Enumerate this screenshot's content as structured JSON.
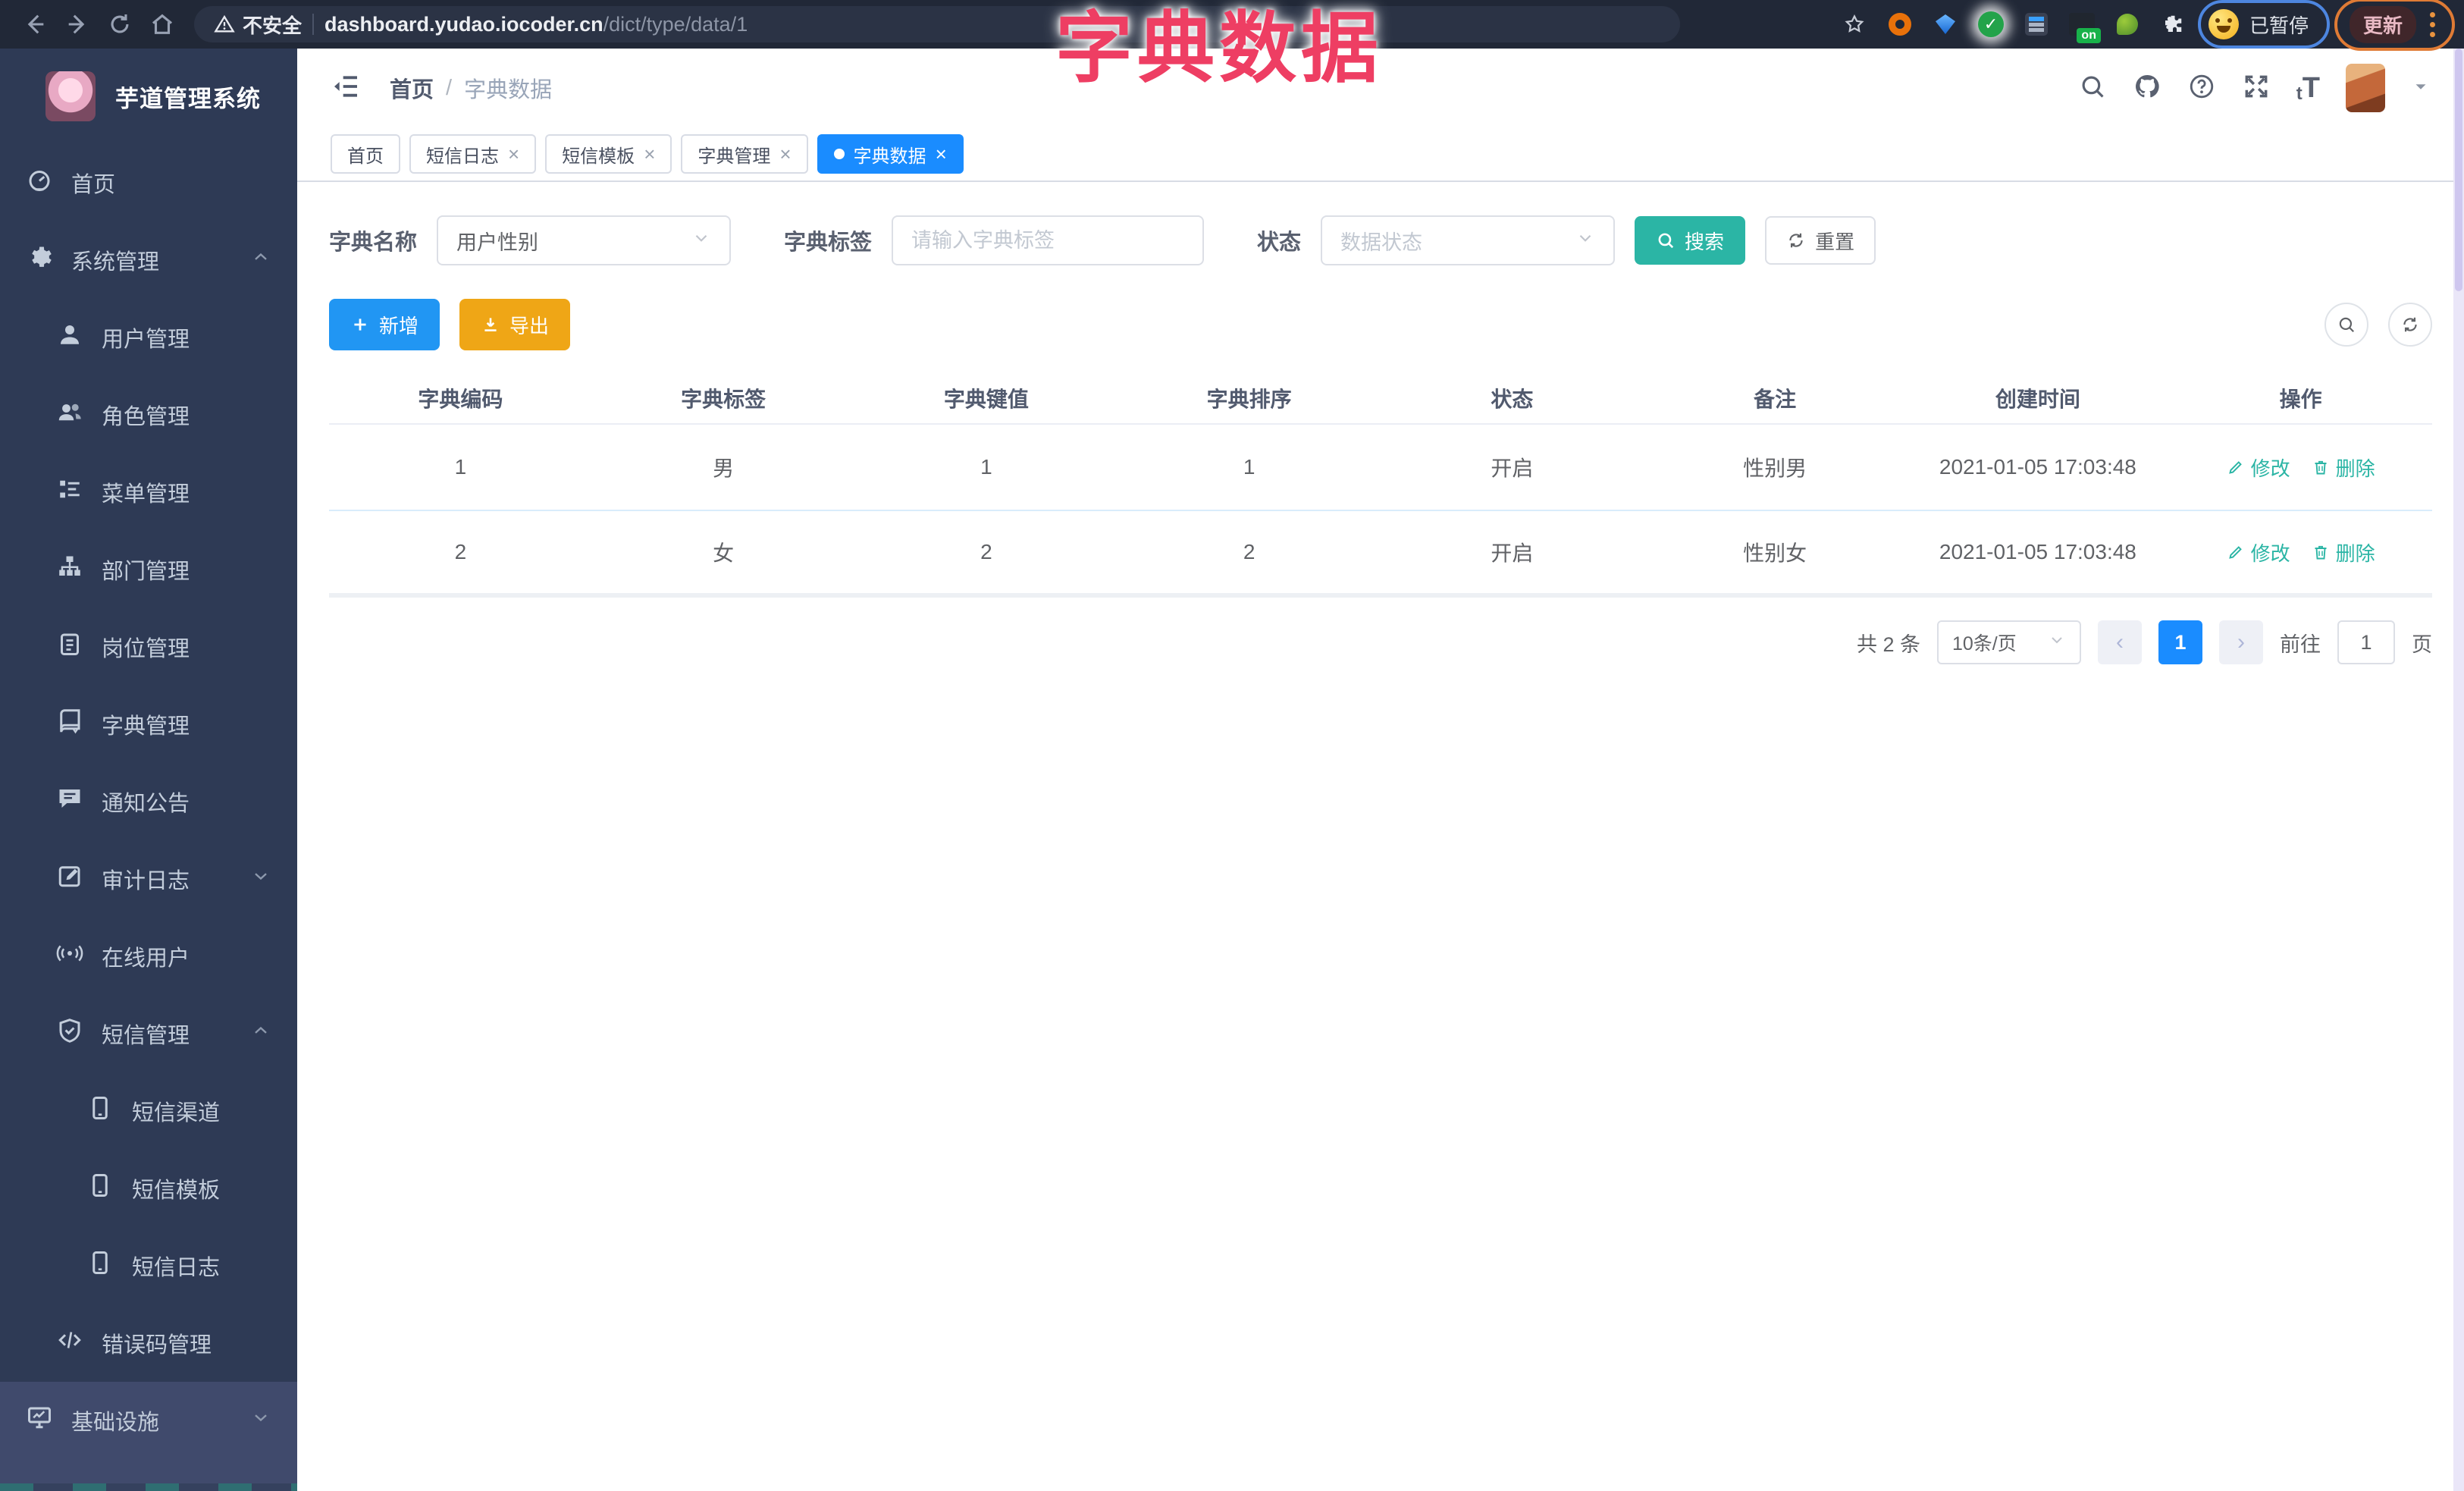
{
  "colors": {
    "accent": "#2bb5a5",
    "primary_blue": "#1a8cff",
    "export_orange": "#efa616",
    "annotation_red": "#ee3e63"
  },
  "overlay_title": "字典数据",
  "browser": {
    "security_label": "不安全",
    "url_host": "dashboard.yudao.iocoder.cn",
    "url_path": "/dict/type/data/1",
    "paused_chip": "已暂停",
    "update_chip": "更新",
    "extension_badge_on": "on",
    "glow_check_glyph": "✓"
  },
  "sidebar": {
    "app_title": "芋道管理系统",
    "items": [
      {
        "label": "首页",
        "icon": "dashboard",
        "level": 0
      },
      {
        "label": "系统管理",
        "icon": "gear",
        "level": 0,
        "chevron": "up"
      },
      {
        "label": "用户管理",
        "icon": "user",
        "level": 1
      },
      {
        "label": "角色管理",
        "icon": "users",
        "level": 1
      },
      {
        "label": "菜单管理",
        "icon": "menu-tree",
        "level": 1
      },
      {
        "label": "部门管理",
        "icon": "org-tree",
        "level": 1
      },
      {
        "label": "岗位管理",
        "icon": "badge",
        "level": 1
      },
      {
        "label": "字典管理",
        "icon": "book",
        "level": 1
      },
      {
        "label": "通知公告",
        "icon": "message",
        "level": 1
      },
      {
        "label": "审计日志",
        "icon": "edit-square",
        "level": 1,
        "chevron": "down"
      },
      {
        "label": "在线用户",
        "icon": "online",
        "level": 1
      },
      {
        "label": "短信管理",
        "icon": "shield-check",
        "level": 1,
        "chevron": "up"
      },
      {
        "label": "短信渠道",
        "icon": "phone",
        "level": 2
      },
      {
        "label": "短信模板",
        "icon": "phone",
        "level": 2
      },
      {
        "label": "短信日志",
        "icon": "phone",
        "level": 2
      },
      {
        "label": "错误码管理",
        "icon": "code",
        "level": 1
      },
      {
        "label": "基础设施",
        "icon": "monitor",
        "level": 0,
        "chevron": "down",
        "highlight": true
      }
    ]
  },
  "header": {
    "breadcrumb_home": "首页",
    "breadcrumb_sep": "/",
    "breadcrumb_current": "字典数据",
    "font_icon_small": "t",
    "font_icon_big": "T"
  },
  "tabs": [
    {
      "label": "首页",
      "closable": false,
      "active": false
    },
    {
      "label": "短信日志",
      "closable": true,
      "active": false
    },
    {
      "label": "短信模板",
      "closable": true,
      "active": false
    },
    {
      "label": "字典管理",
      "closable": true,
      "active": false
    },
    {
      "label": "字典数据",
      "closable": true,
      "active": true
    }
  ],
  "filters": {
    "name_label": "字典名称",
    "name_value": "用户性别",
    "tag_label": "字典标签",
    "tag_placeholder": "请输入字典标签",
    "status_label": "状态",
    "status_placeholder": "数据状态",
    "search_label": "搜索",
    "reset_label": "重置"
  },
  "toolbar": {
    "add_label": "新增",
    "export_label": "导出"
  },
  "table": {
    "headers": [
      "字典编码",
      "字典标签",
      "字典键值",
      "字典排序",
      "状态",
      "备注",
      "创建时间",
      "操作"
    ],
    "rows": [
      {
        "code": "1",
        "label": "男",
        "value": "1",
        "sort": "1",
        "status": "开启",
        "remark": "性别男",
        "created": "2021-01-05 17:03:48"
      },
      {
        "code": "2",
        "label": "女",
        "value": "2",
        "sort": "2",
        "status": "开启",
        "remark": "性别女",
        "created": "2021-01-05 17:03:48"
      }
    ],
    "edit_label": "修改",
    "delete_label": "删除"
  },
  "pagination": {
    "total_label": "共 2 条",
    "page_size": "10条/页",
    "prev_glyph": "‹",
    "next_glyph": "›",
    "current_page": "1",
    "goto_label": "前往",
    "goto_value": "1",
    "page_unit": "页"
  }
}
